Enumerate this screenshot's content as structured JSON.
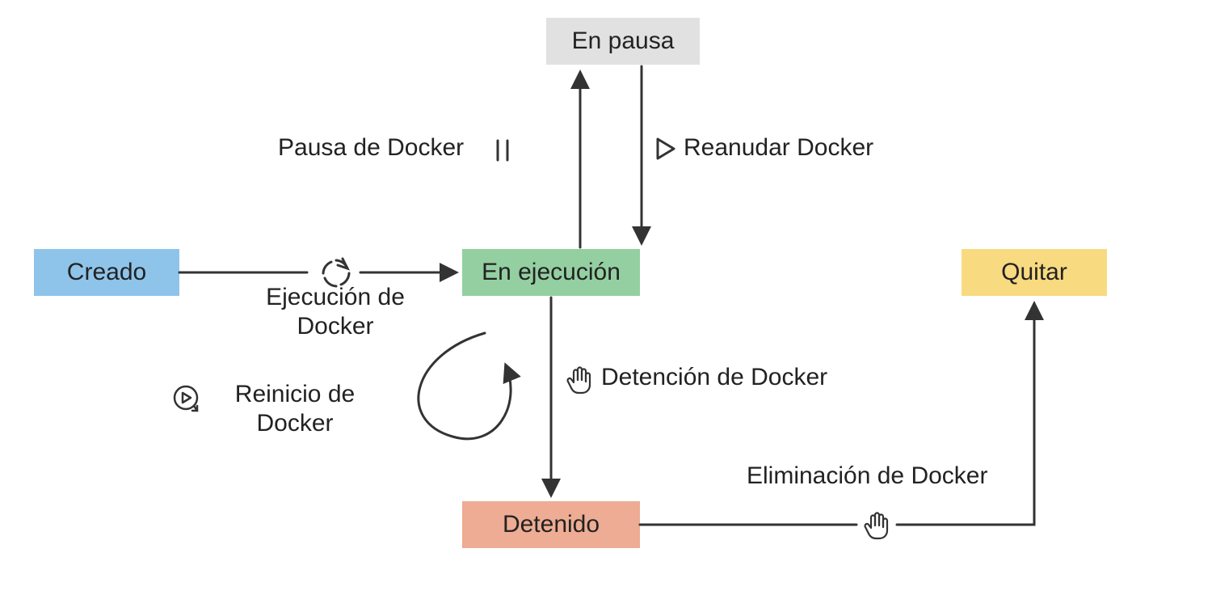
{
  "states": {
    "created": {
      "label": "Creado",
      "color": "#8fc4ea"
    },
    "running": {
      "label": "En ejecución",
      "color": "#94cfa1"
    },
    "paused": {
      "label": "En pausa",
      "color": "#e1e1e1"
    },
    "stopped": {
      "label": "Detenido",
      "color": "#edac93"
    },
    "removed": {
      "label": "Quitar",
      "color": "#f8da80"
    }
  },
  "labels": {
    "pause": "Pausa de Docker",
    "unpause": "Reanudar Docker",
    "run": "Ejecución de Docker",
    "restart": "Reinicio de Docker",
    "stop": "Detención de Docker",
    "remove": "Eliminación de Docker"
  },
  "colors": {
    "stroke": "#333333"
  }
}
